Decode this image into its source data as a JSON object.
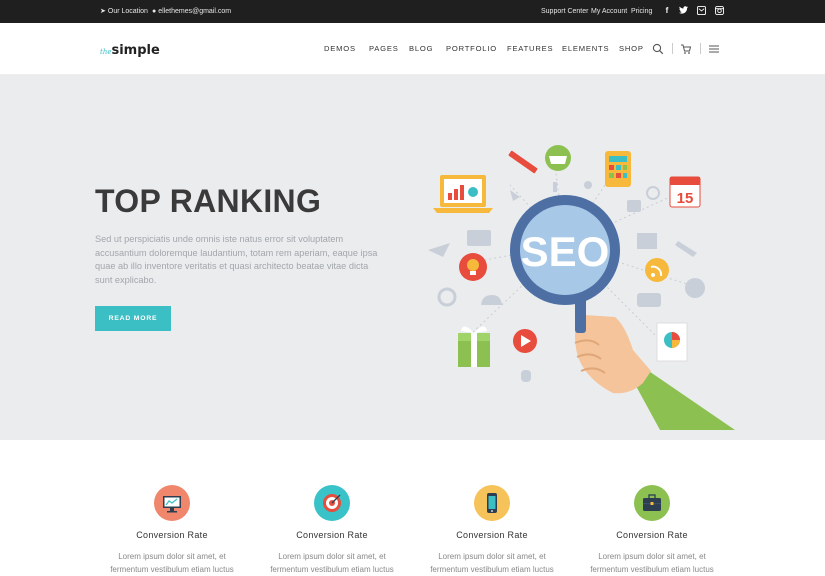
{
  "topbar": {
    "location": "Our Location",
    "email": "ellethemes@gmail.com",
    "links": [
      "Support Center",
      "My Account",
      "Pricing"
    ],
    "social_icons": [
      "facebook-icon",
      "twitter-icon",
      "mail-icon",
      "instagram-icon"
    ]
  },
  "nav": {
    "logo_prefix": "the",
    "logo_name": "simple",
    "menu": [
      "DEMOS",
      "PAGES",
      "BLOG",
      "PORTFOLIO",
      "FEATURES",
      "ELEMENTS",
      "SHOP"
    ],
    "icons": [
      "search-icon",
      "cart-icon",
      "menu-icon"
    ]
  },
  "hero": {
    "title": "TOP RANKING",
    "text": "Sed ut perspiciatis unde omnis iste natus error sit voluptatem accusantium doloremque laudantium, totam rem aperiam, eaque ipsa quae ab illo inventore veritatis et quasi architecto beatae vitae dicta sunt explicabo.",
    "button": "READ MORE",
    "illustration_text": "SEO",
    "calendar_day": "15"
  },
  "features": [
    {
      "title": "Conversion Rate",
      "text_lines": [
        "Lorem ipsum dolor sit amet, et",
        "fermentum vestibulum etiam luctus"
      ],
      "icon": "monitor-chart-icon",
      "color": "#f0876c"
    },
    {
      "title": "Conversion Rate",
      "text_lines": [
        "Lorem ipsum dolor sit amet, et",
        "fermentum vestibulum etiam luctus"
      ],
      "icon": "target-icon",
      "color": "#39c3c9"
    },
    {
      "title": "Conversion Rate",
      "text_lines": [
        "Lorem ipsum dolor sit amet, et",
        "fermentum vestibulum etiam luctus"
      ],
      "icon": "phone-icon",
      "color": "#f6c35a"
    },
    {
      "title": "Conversion Rate",
      "text_lines": [
        "Lorem ipsum dolor sit amet, et",
        "fermentum vestibulum etiam luctus"
      ],
      "icon": "briefcase-icon",
      "color": "#8cc152"
    }
  ],
  "colors": {
    "accent": "#3bbfc4",
    "topbar_bg": "#1f1f1f",
    "hero_bg": "#ebecee"
  }
}
